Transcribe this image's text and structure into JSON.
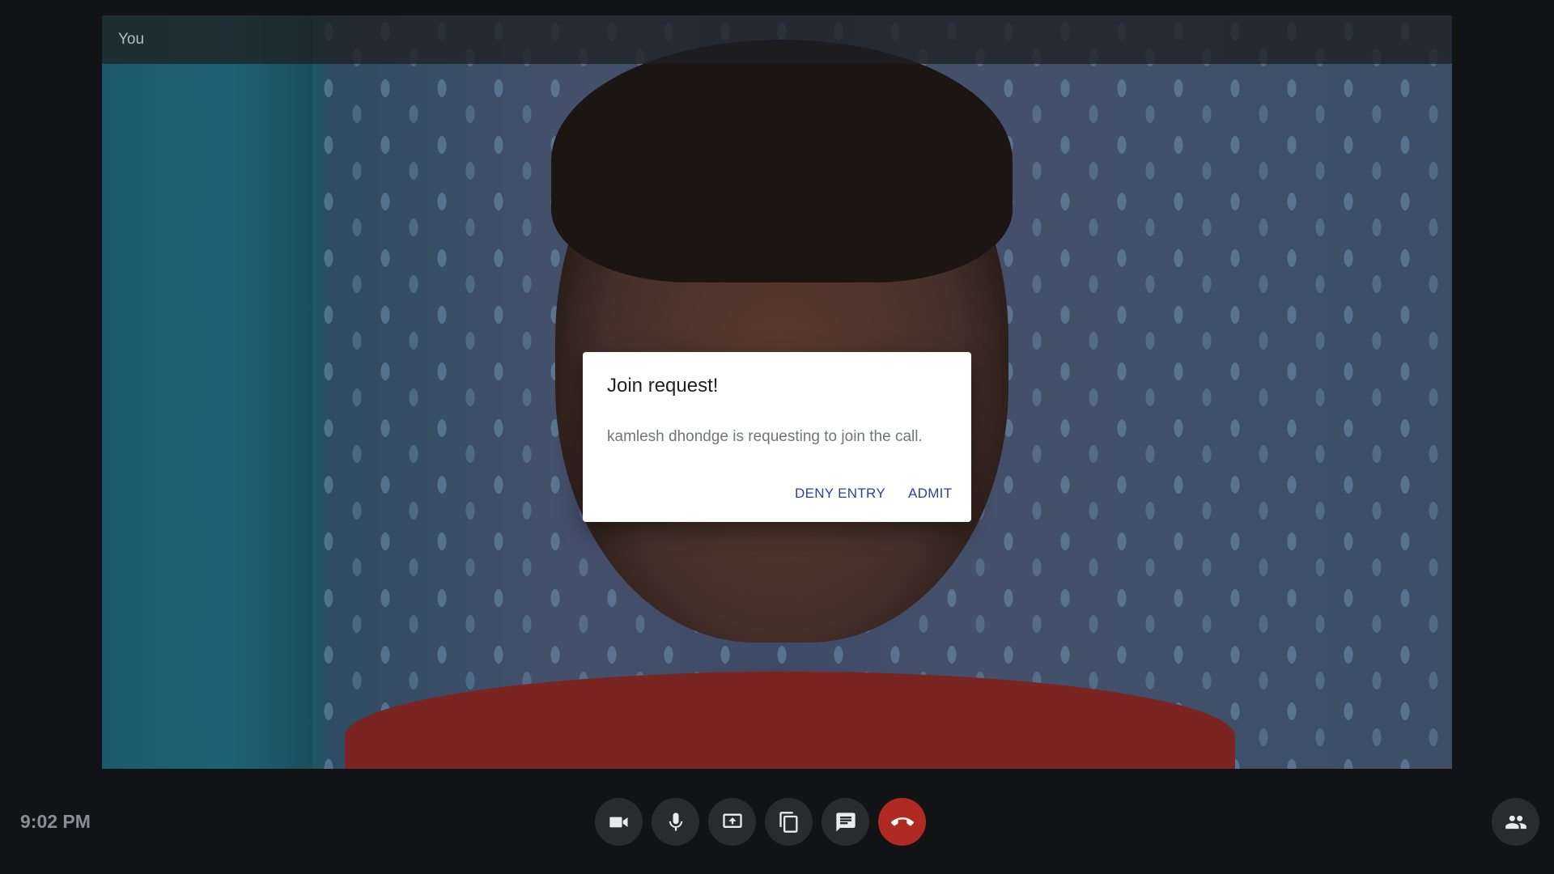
{
  "tile": {
    "participant_name": "You"
  },
  "dialog": {
    "title": "Join request!",
    "message": "kamlesh dhondge is requesting to join the call.",
    "deny_label": "DENY ENTRY",
    "admit_label": "ADMIT"
  },
  "status": {
    "time": "9:02 PM"
  },
  "controls": [
    {
      "icon": "video-camera-icon"
    },
    {
      "icon": "microphone-icon"
    },
    {
      "icon": "screen-share-icon"
    },
    {
      "icon": "copy-icon"
    },
    {
      "icon": "chat-icon"
    },
    {
      "icon": "end-call-icon"
    }
  ],
  "people_button": {
    "icon": "people-icon"
  },
  "colors": {
    "background": "#121316",
    "control_bg": "#2a2b2f",
    "end_call": "#b02a22",
    "dialog_action": "#2f3f9e"
  }
}
